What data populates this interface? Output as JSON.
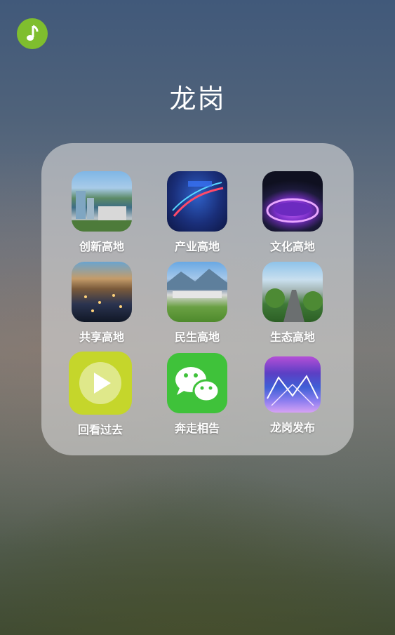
{
  "music_button": {
    "icon": "music-note-icon"
  },
  "folder": {
    "title": "龙岗",
    "apps": [
      {
        "label": "创新高地",
        "icon": "city-skyline-icon"
      },
      {
        "label": "产业高地",
        "icon": "corridor-map-icon"
      },
      {
        "label": "文化高地",
        "icon": "stadium-icon"
      },
      {
        "label": "共享高地",
        "icon": "night-city-icon"
      },
      {
        "label": "民生高地",
        "icon": "green-city-icon"
      },
      {
        "label": "生态高地",
        "icon": "tree-lined-road-icon"
      },
      {
        "label": "回看过去",
        "icon": "play-video-icon"
      },
      {
        "label": "奔走相告",
        "icon": "wechat-icon"
      },
      {
        "label": "龙岗发布",
        "icon": "light-sculpture-icon"
      }
    ]
  }
}
